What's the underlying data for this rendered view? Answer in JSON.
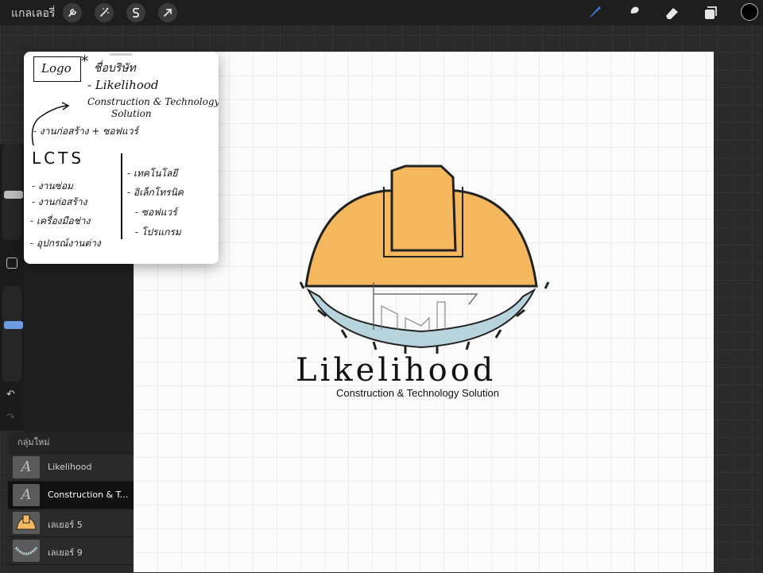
{
  "topbar": {
    "gallery_label": "แกลเลอรี่",
    "tools": [
      {
        "icon": "wrench-icon"
      },
      {
        "icon": "magic-wand-icon"
      },
      {
        "icon": "selection-s-icon"
      },
      {
        "icon": "transform-arrow-icon"
      }
    ],
    "right_tools": [
      {
        "icon": "brush-icon"
      },
      {
        "icon": "smudge-icon"
      },
      {
        "icon": "eraser-icon"
      },
      {
        "icon": "layers-icon"
      }
    ],
    "current_color": "#000000",
    "accent_color": "#3a7bd5"
  },
  "note": {
    "box_label": "Logo",
    "star": "*",
    "heading": "ชื่อบริษัท",
    "item1": "- Likelihood",
    "item2_line1": "Construction & Technology",
    "item2_line2": "Solution",
    "line3": "- งานก่อสร้าง + ซอฟแวร์",
    "acronym": "LCTS",
    "left_list": [
      "- งานซ่อม",
      "- งานก่อสร้าง",
      "- เครื่องมือช่าง",
      "- อุปกรณ์งานต่าง"
    ],
    "right_list": [
      "- เทคโนโลยี",
      "- อิเล็กโทรนิค",
      "- ซอฟแวร์",
      "- โปรแกรม"
    ]
  },
  "logo": {
    "title": "Likelihood",
    "subtitle": "Construction & Technology Solution",
    "helmet_color": "#f5b85e",
    "gear_color": "#b7d4dc"
  },
  "layers": {
    "group_name": "กลุ่มใหม่",
    "items": [
      {
        "name": "Likelihood",
        "thumb": "A",
        "active": false
      },
      {
        "name": "Construction & Techn...",
        "thumb": "A",
        "active": true
      },
      {
        "name": "เลเยอร์ 5",
        "thumb": "helmet",
        "active": false
      },
      {
        "name": "เลเยอร์ 9",
        "thumb": "arc",
        "active": false
      }
    ]
  }
}
